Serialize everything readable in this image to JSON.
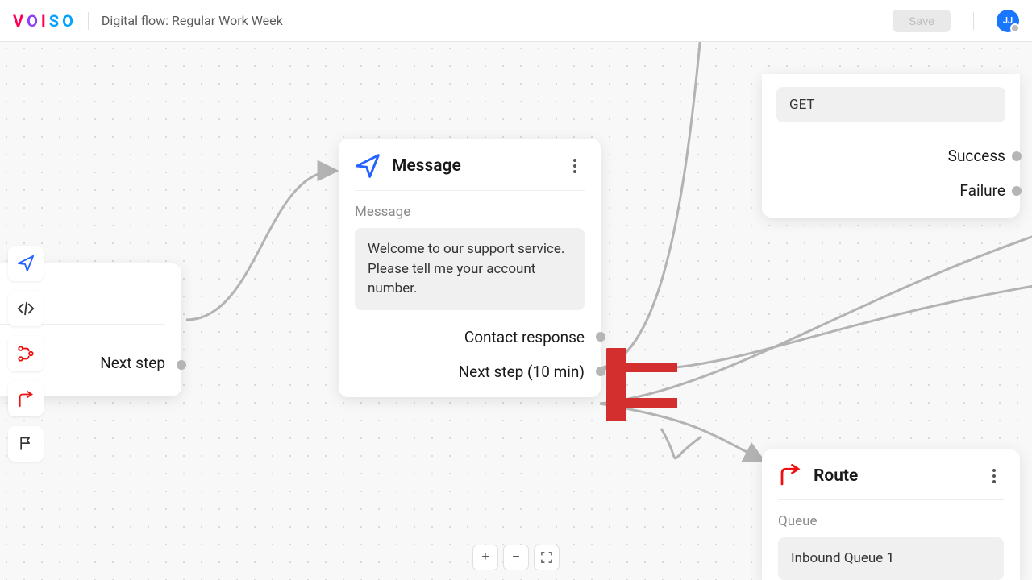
{
  "header": {
    "logo_text": "VOISO",
    "title_prefix": "Digital flow: ",
    "flow_name": "Regular Work Week",
    "save_label": "Save",
    "user_initials": "JJ"
  },
  "toolbox": {
    "items": [
      {
        "name": "message-tool"
      },
      {
        "name": "code-tool"
      },
      {
        "name": "branch-tool"
      },
      {
        "name": "route-tool"
      },
      {
        "name": "flag-tool"
      }
    ]
  },
  "nodes": {
    "partial_left": {
      "outputs": [
        {
          "label": "Next step"
        }
      ]
    },
    "message": {
      "title": "Message",
      "section_label": "Message",
      "message_body": "Welcome to our support service. Please tell me your account number.",
      "outputs": [
        {
          "label": "Contact response"
        },
        {
          "label": "Next step (10 min)"
        }
      ]
    },
    "api": {
      "method": "GET",
      "outputs": [
        {
          "label": "Success"
        },
        {
          "label": "Failure"
        }
      ]
    },
    "route": {
      "title": "Route",
      "section_label": "Queue",
      "queue_value": "Inbound Queue 1"
    }
  },
  "zoom": {
    "in": "+",
    "out": "−",
    "fit": "⛶"
  }
}
